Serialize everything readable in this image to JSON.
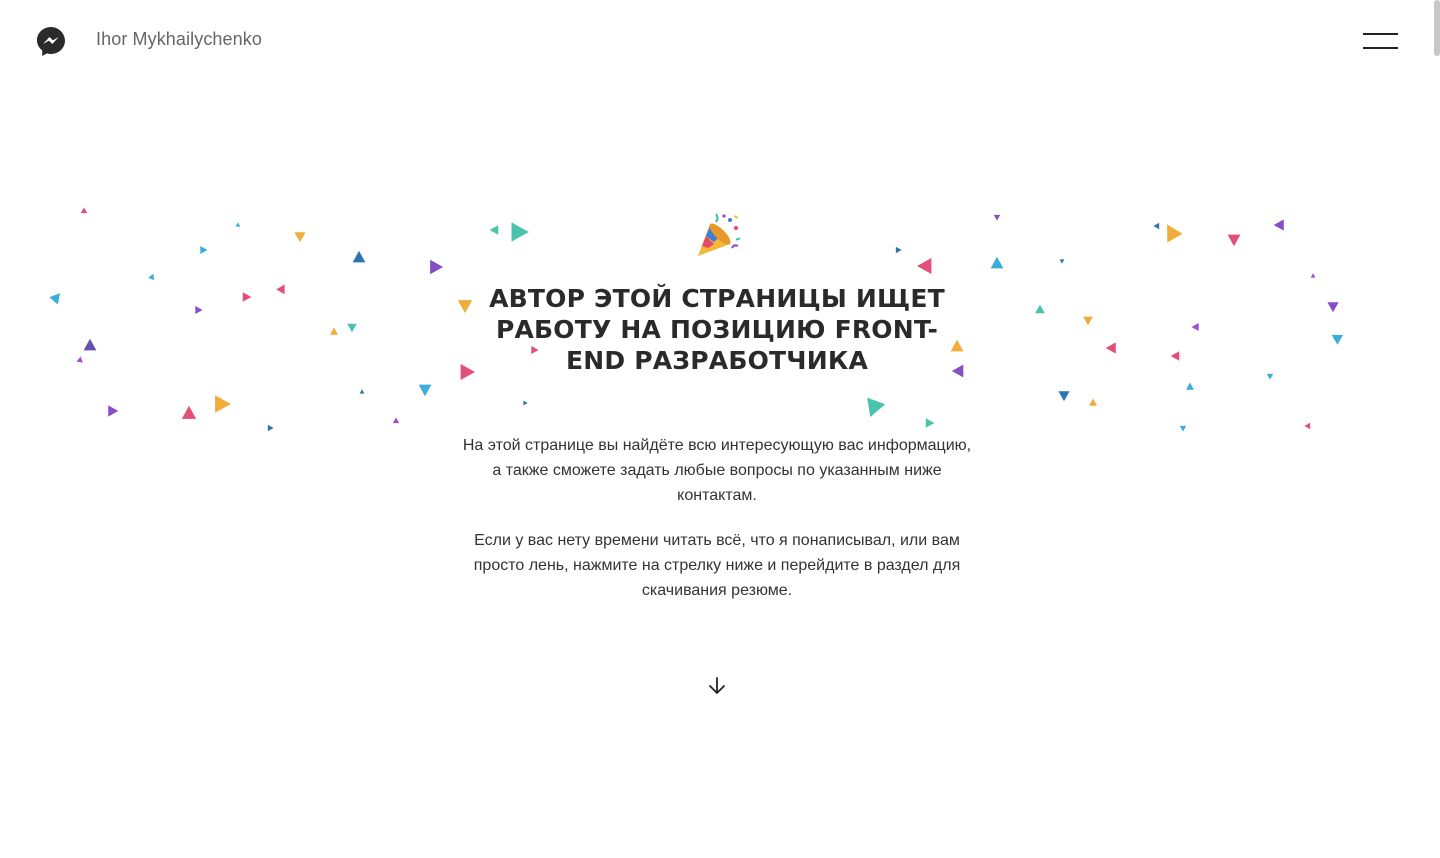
{
  "header": {
    "logo_icon": "messenger-icon",
    "brand_name": "Ihor Mykhailychenko",
    "menu_icon": "hamburger-menu-icon"
  },
  "hero": {
    "emoji_icon": "party-popper-icon",
    "title": "АВТОР ЭТОЙ СТРАНИЦЫ ИЩЕТ РАБОТУ НА ПОЗИЦИЮ FRONT-END РАЗРАБОТЧИКА",
    "paragraph_1": "На этой странице вы найдёте всю интересующую вас информацию, а также сможете задать любые вопросы по указанным ниже контактам.",
    "paragraph_2": "Если у вас нету времени читать всё, что я понаписывал, или вам просто лень, нажмите на стрелку ниже и перейдите в раздел для скачивания резюме.",
    "scroll_icon": "arrow-down-icon"
  },
  "colors": {
    "confetti": [
      "#5b3fa8",
      "#7b3fc0",
      "#e0406e",
      "#f0a62a",
      "#2aa6d6",
      "#3bbfa6",
      "#1a6aa8",
      "#9a3fd0"
    ]
  }
}
